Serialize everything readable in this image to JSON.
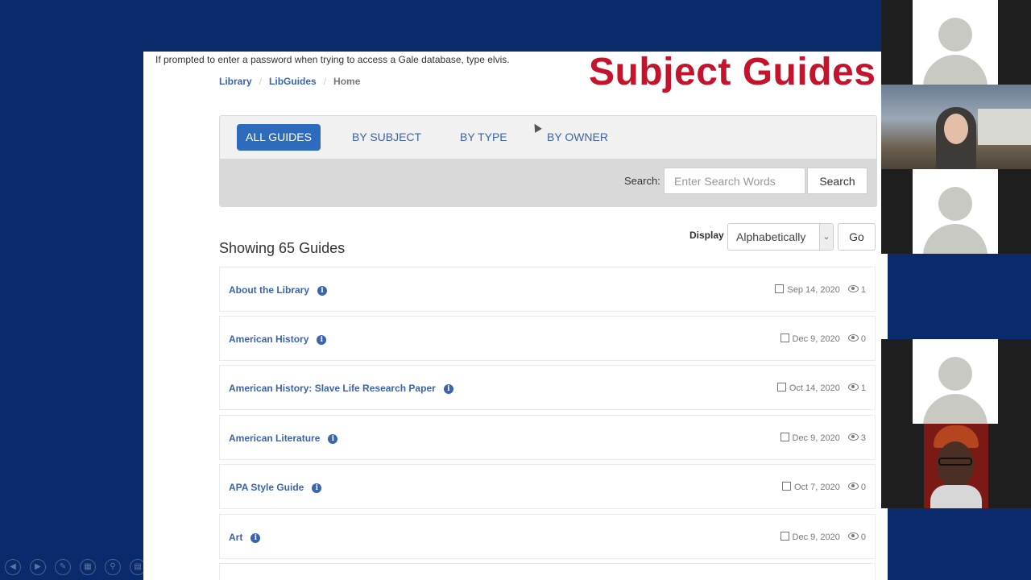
{
  "notice": "If prompted to enter a password when trying to access a Gale database, type elvis.",
  "headline": "Subject Guides",
  "breadcrumb": {
    "items": [
      "Library",
      "LibGuides",
      "Home"
    ]
  },
  "tabs": [
    {
      "label": "ALL GUIDES",
      "active": true
    },
    {
      "label": "BY SUBJECT",
      "active": false
    },
    {
      "label": "BY TYPE",
      "active": false
    },
    {
      "label": "BY OWNER",
      "active": false
    }
  ],
  "search": {
    "label": "Search:",
    "placeholder": "Enter Search Words",
    "button": "Search"
  },
  "showing": "Showing 65 Guides",
  "display": {
    "label": "Display",
    "selected": "Alphabetically",
    "go": "Go"
  },
  "guides": [
    {
      "title": "About the Library",
      "date": "Sep 14, 2020",
      "views": "1"
    },
    {
      "title": "American History",
      "date": "Dec 9, 2020",
      "views": "0"
    },
    {
      "title": "American History: Slave Life Research Paper",
      "date": "Oct 14, 2020",
      "views": "1"
    },
    {
      "title": "American Literature",
      "date": "Dec 9, 2020",
      "views": "3"
    },
    {
      "title": "APA Style Guide",
      "date": "Oct 7, 2020",
      "views": "0"
    },
    {
      "title": "Art",
      "date": "Dec 9, 2020",
      "views": "0"
    }
  ],
  "colors": {
    "accent": "#2d6bbd",
    "headline": "#c4142c",
    "background": "#0a2a6b",
    "link": "#3a63b0"
  },
  "icons": [
    "info-icon",
    "edit-icon",
    "eye-icon",
    "chevron-down-icon",
    "avatar-placeholder-icon"
  ]
}
